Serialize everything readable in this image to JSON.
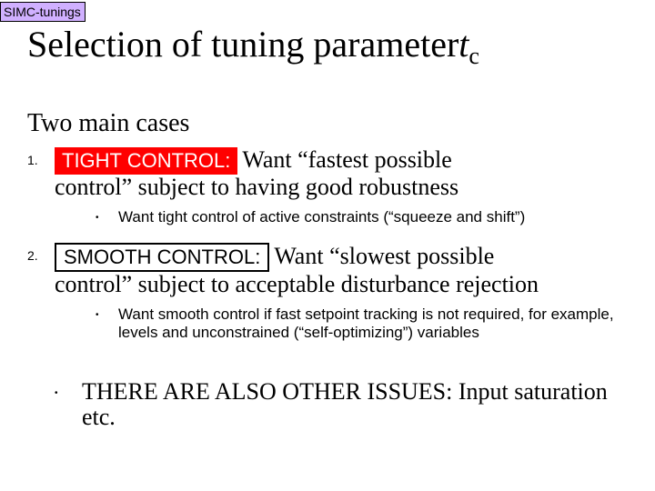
{
  "tag": "SIMC-tunings",
  "title_main": "Selection of tuning parameter",
  "title_tau": "t",
  "title_sub": "c",
  "lead": "Two main cases",
  "item1": {
    "num": "1.",
    "badge": "TIGHT CONTROL:",
    "text_a": "Want “fastest possible",
    "text_b": "control” subject to having good robustness",
    "sub": "Want tight control of active constraints (“squeeze and shift”)"
  },
  "item2": {
    "num": "2.",
    "badge": "SMOOTH CONTROL:",
    "text_a": "Want “slowest possible",
    "text_b": "control” subject to acceptable disturbance rejection",
    "sub": "Want smooth control if fast setpoint tracking is not required, for example, levels and unconstrained (“self-optimizing”) variables"
  },
  "final": "THERE ARE ALSO OTHER ISSUES: Input saturation etc.",
  "bullet": "•"
}
